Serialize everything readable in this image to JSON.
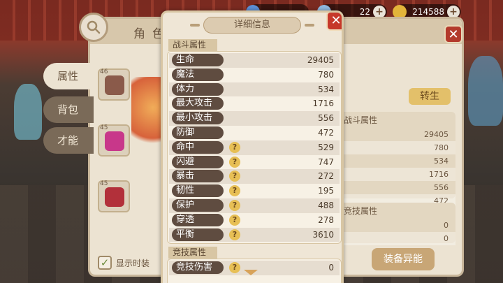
{
  "resources": [
    {
      "name": "diamond",
      "value": "",
      "color": "#5c8fd6"
    },
    {
      "name": "silver",
      "value": "22",
      "color": "#8fb8e0"
    },
    {
      "name": "gold",
      "value": "214588",
      "color": "#e3b43a"
    }
  ],
  "role_panel": {
    "title": "角色",
    "side_tabs": [
      "属性",
      "背包",
      "才能"
    ],
    "equip_levels": [
      "46",
      "45",
      "45"
    ],
    "show_fashion_label": "显示时装",
    "rebirth_button": "转生",
    "equip_special_button": "装备异能",
    "right_battle_header": "战斗属性",
    "right_battle_values": [
      "29405",
      "780",
      "534",
      "1716",
      "556",
      "472"
    ],
    "right_arena_header": "竞技属性",
    "right_arena_values": [
      "0",
      "0"
    ]
  },
  "detail": {
    "title": "详细信息",
    "close": "✕",
    "battle_section": "战斗属性",
    "battle_stats": [
      {
        "label": "生命",
        "value": "29405",
        "help": false
      },
      {
        "label": "魔法",
        "value": "780",
        "help": false
      },
      {
        "label": "体力",
        "value": "534",
        "help": false
      },
      {
        "label": "最大攻击",
        "value": "1716",
        "help": false
      },
      {
        "label": "最小攻击",
        "value": "556",
        "help": false
      },
      {
        "label": "防御",
        "value": "472",
        "help": false
      },
      {
        "label": "命中",
        "value": "529",
        "help": true
      },
      {
        "label": "闪避",
        "value": "747",
        "help": true
      },
      {
        "label": "暴击",
        "value": "272",
        "help": true
      },
      {
        "label": "韧性",
        "value": "195",
        "help": true
      },
      {
        "label": "保护",
        "value": "488",
        "help": true
      },
      {
        "label": "穿透",
        "value": "278",
        "help": true
      },
      {
        "label": "平衡",
        "value": "3610",
        "help": true
      }
    ],
    "arena_section": "竞技属性",
    "arena_stats": [
      {
        "label": "竞技伤害",
        "value": "0",
        "help": true
      }
    ],
    "help_glyph": "?"
  }
}
